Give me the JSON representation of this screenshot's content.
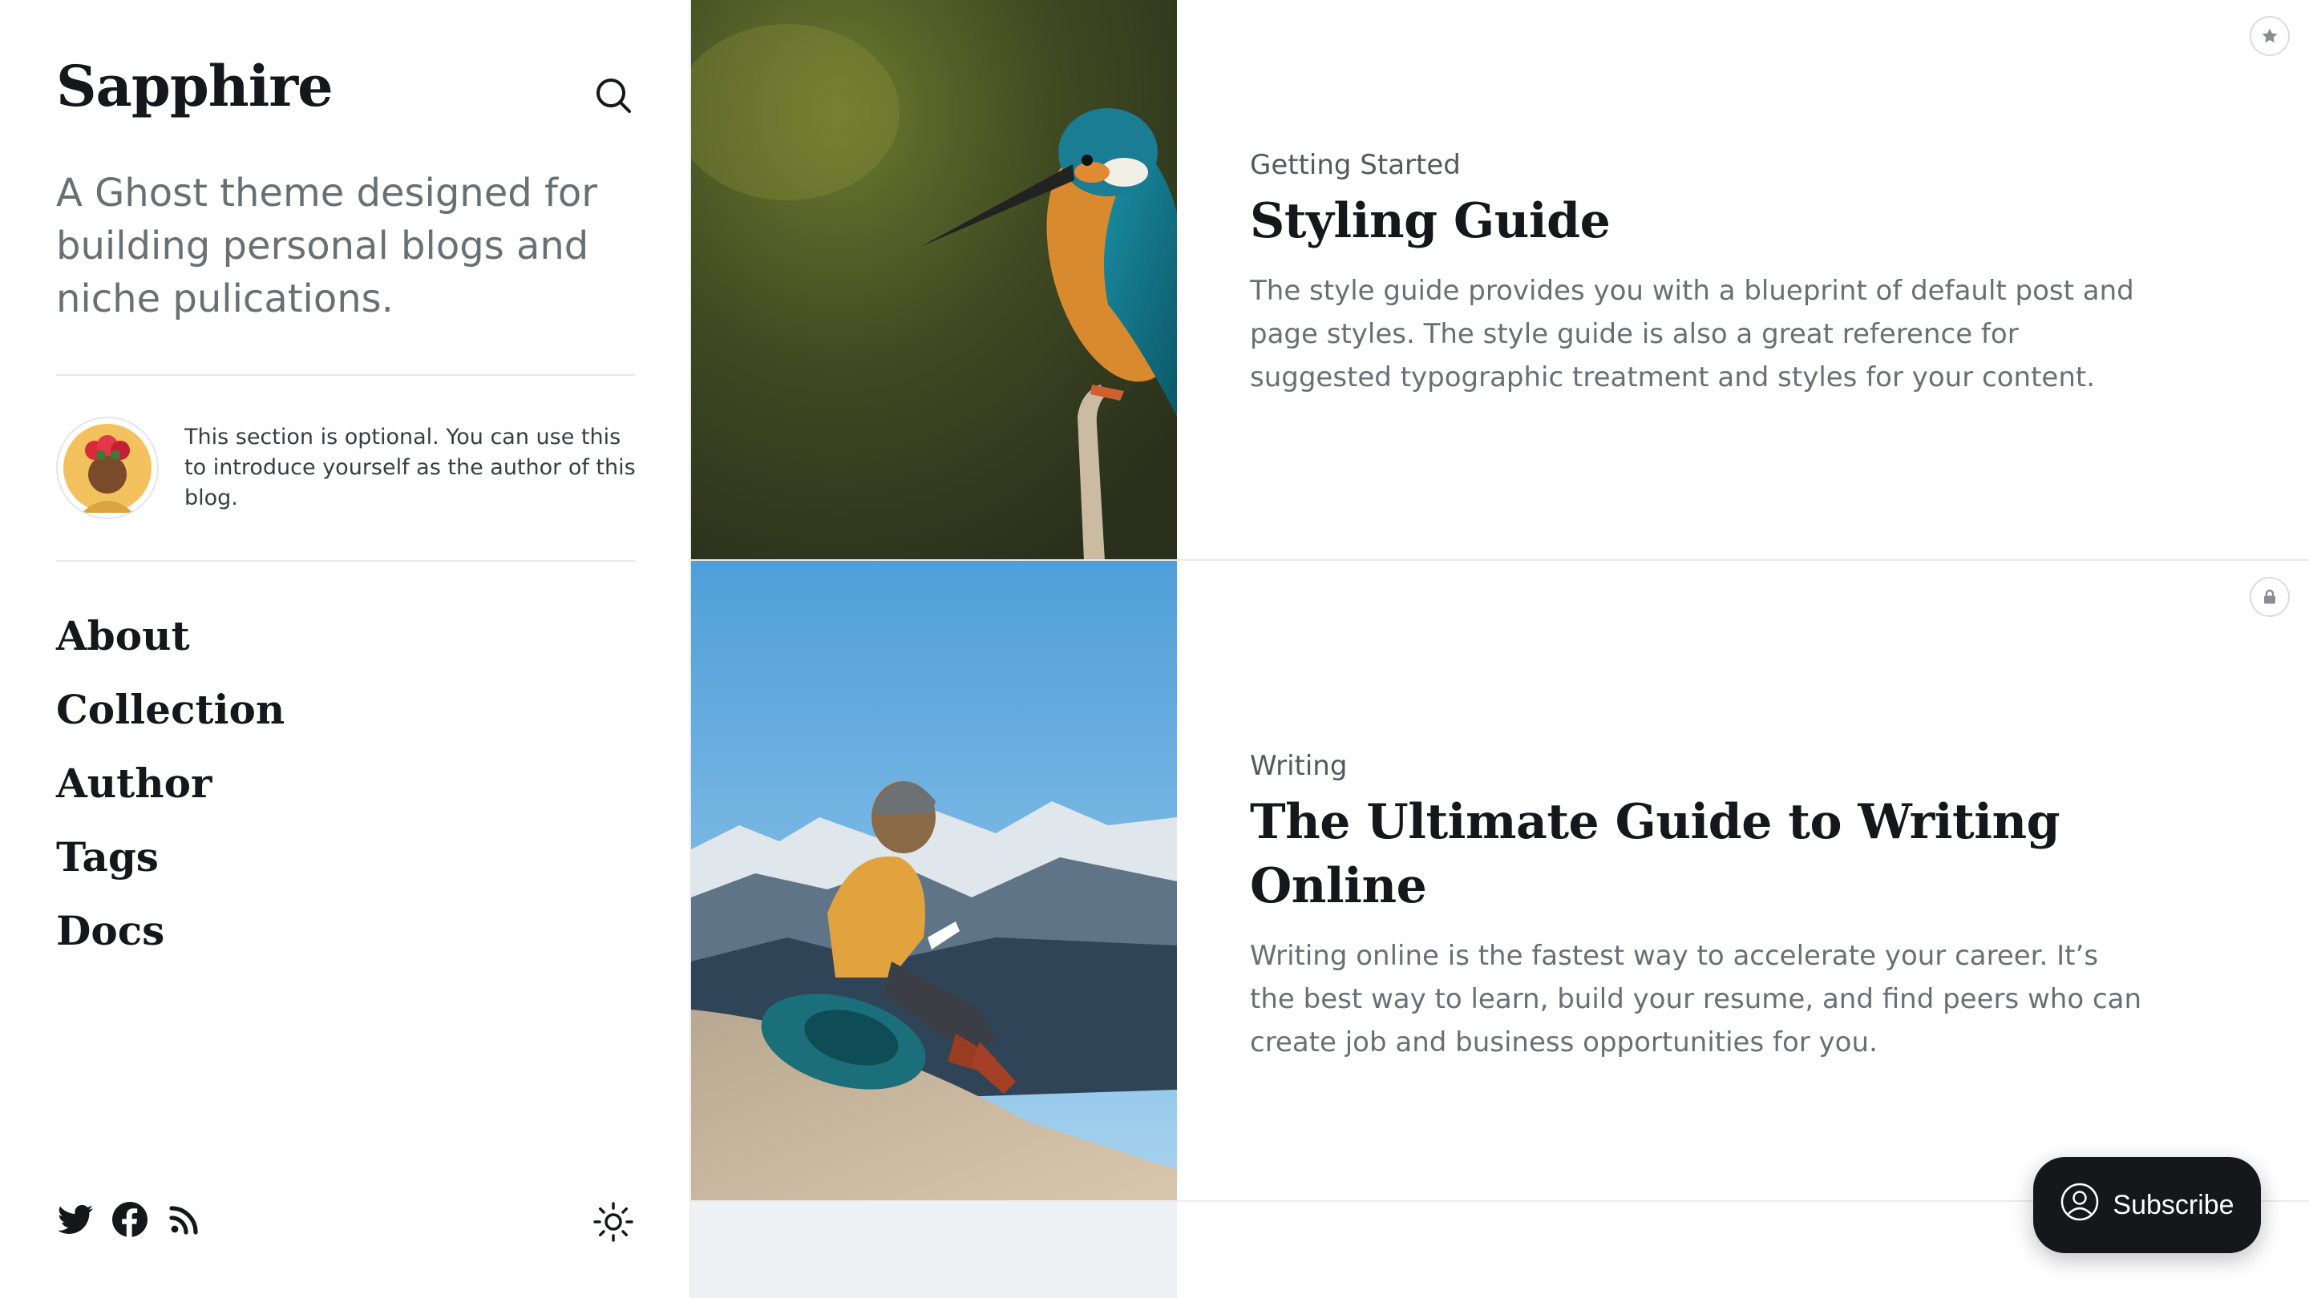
{
  "site": {
    "title": "Sapphire",
    "description": "A Ghost theme designed for building personal blogs and niche pulications."
  },
  "author": {
    "bio": "This section is optional. You can use this to introduce yourself as the author of this blog."
  },
  "navigation": [
    {
      "label": "About"
    },
    {
      "label": "Collection"
    },
    {
      "label": "Author"
    },
    {
      "label": "Tags"
    },
    {
      "label": "Docs"
    }
  ],
  "social_icons": [
    "twitter-icon",
    "facebook-icon",
    "rss-icon"
  ],
  "posts": [
    {
      "tag": "Getting Started",
      "title": "Styling Guide",
      "excerpt": "The style guide provides you with a blueprint of default post and page styles. The style guide is also a great reference for suggested typographic treatment and styles for your content.",
      "badge_icon": "star-icon"
    },
    {
      "tag": "Writing",
      "title": "The Ultimate Guide to Writing Online",
      "excerpt": "Writing online is the fastest way to accelerate your career. It’s the best way to learn, build your resume, and find peers who can create job and business opportunities for you.",
      "badge_icon": "lock-icon"
    }
  ],
  "subscribe": {
    "label": "Subscribe"
  },
  "colors": {
    "text": "#15171a",
    "muted": "#6b6f73",
    "accent_button": "#15171a"
  }
}
